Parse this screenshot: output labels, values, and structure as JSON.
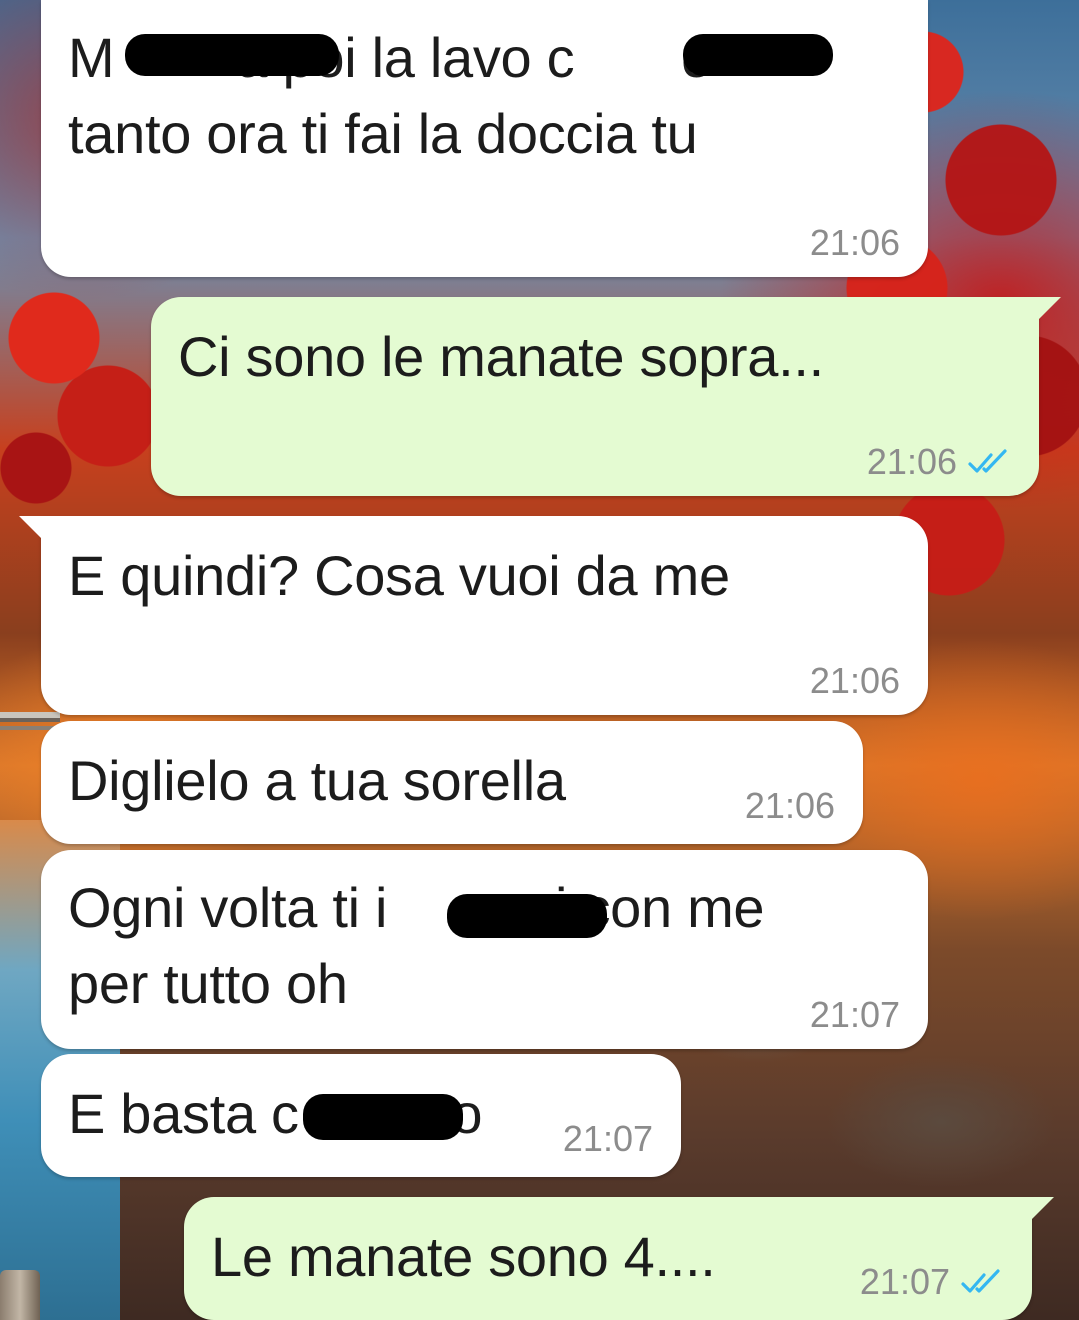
{
  "colors": {
    "incoming_bubble": "#ffffff",
    "outgoing_bubble": "#e4fbd2",
    "text": "#1c1c1c",
    "timestamp": "#8c8c8c",
    "read_ticks": "#34b7f1"
  },
  "messages": [
    {
      "direction": "incoming",
      "text": "M        a poi la lavo c       o\ntanto ora ti fai la doccia tu",
      "time": "21:06"
    },
    {
      "direction": "outgoing",
      "text": "Ci sono le manate sopra...",
      "time": "21:06",
      "status_icon": "double-check-read-icon"
    },
    {
      "direction": "incoming",
      "text": "E quindi? Cosa vuoi da me",
      "time": "21:06"
    },
    {
      "direction": "incoming",
      "text": "Diglielo a tua sorella",
      "time": "21:06"
    },
    {
      "direction": "incoming",
      "text": "Ogni volta ti i           i con me\nper tutto oh",
      "time": "21:07"
    },
    {
      "direction": "incoming",
      "text": "E basta c          o",
      "time": "21:07"
    },
    {
      "direction": "outgoing",
      "text": "Le manate sono 4....",
      "time": "21:07",
      "status_icon": "double-check-read-icon"
    }
  ]
}
